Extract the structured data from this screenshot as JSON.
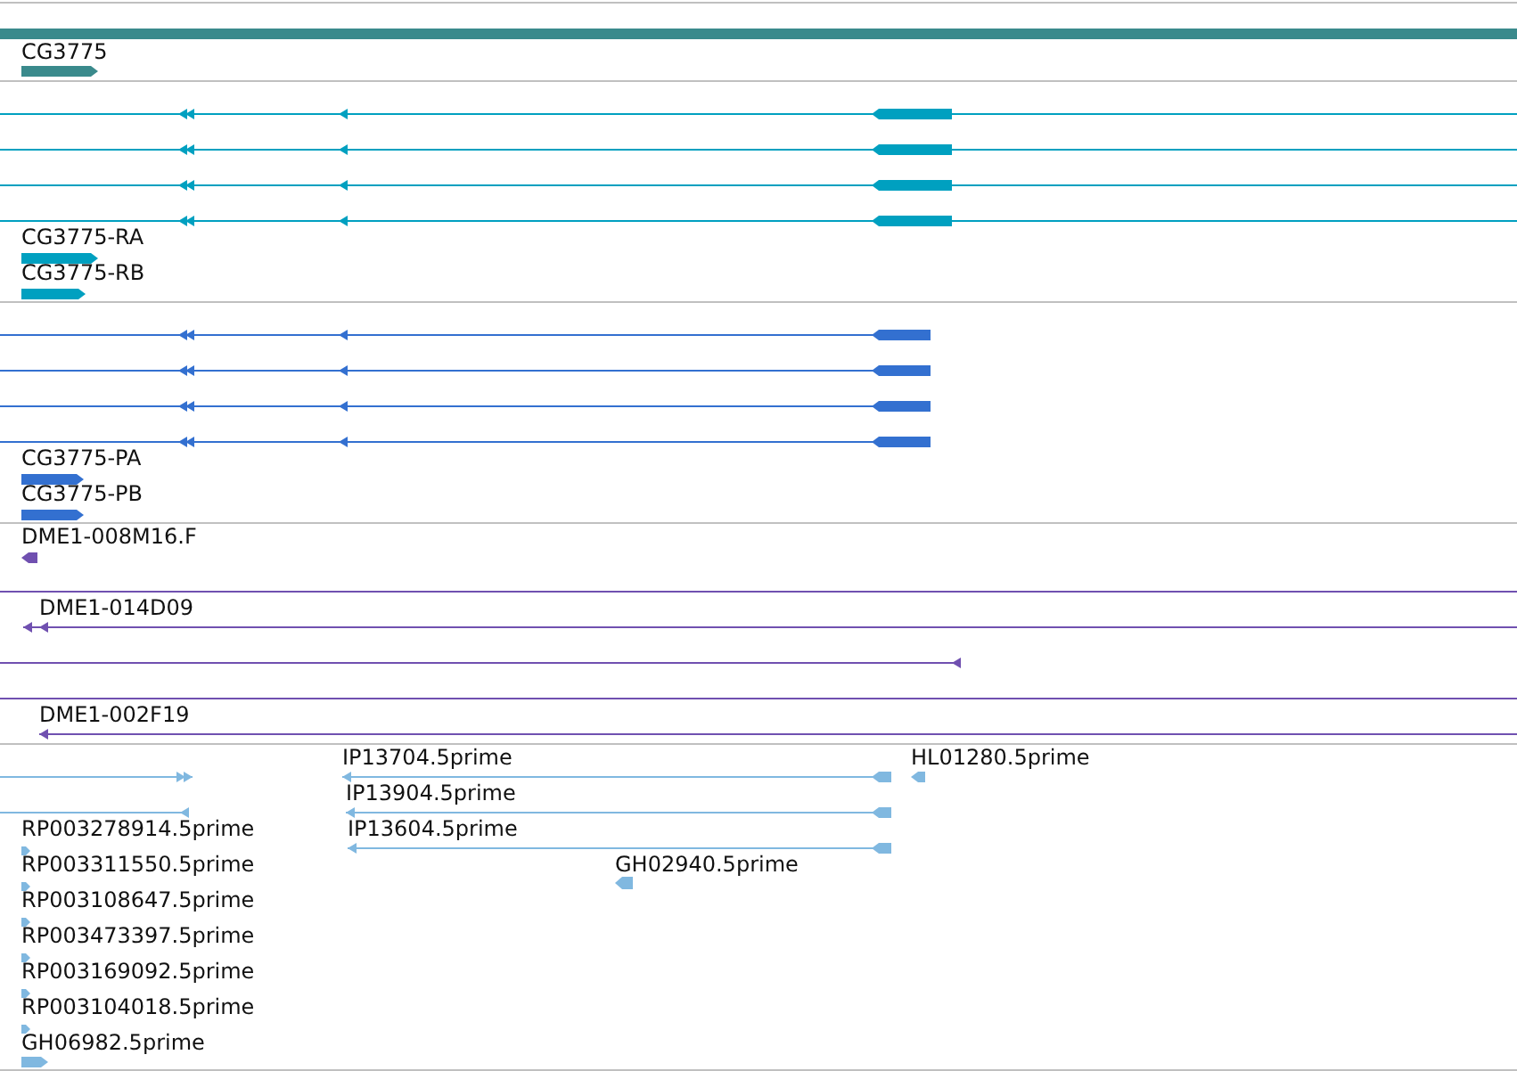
{
  "tracks": [
    {
      "color": "#3a8a8c",
      "features": [
        {
          "label": "CG3775",
          "reverse": false
        }
      ]
    },
    {
      "color": "#00a0c0",
      "features": [
        {
          "label": "CG3775-RA",
          "reverse": false
        },
        {
          "label": "CG3775-RB",
          "reverse": false
        }
      ]
    },
    {
      "color": "#3370d0",
      "features": [
        {
          "label": "CG3775-PA",
          "reverse": false
        },
        {
          "label": "CG3775-PB",
          "reverse": false
        }
      ]
    },
    {
      "color": "#7050b0",
      "features": [
        {
          "label": "DME1-008M16.F",
          "reverse": true
        },
        {
          "label": "DME1-014D09",
          "reverse": true
        },
        {
          "label": "DME1-002F19",
          "reverse": true
        }
      ]
    },
    {
      "color": "#80b8e0",
      "features": [
        {
          "label": "IP13704.5prime",
          "reverse": true
        },
        {
          "label": "HL01280.5prime",
          "reverse": true
        },
        {
          "label": "IP13904.5prime",
          "reverse": true
        },
        {
          "label": "RP003278914.5prime",
          "reverse": false
        },
        {
          "label": "IP13604.5prime",
          "reverse": true
        },
        {
          "label": "RP003311550.5prime",
          "reverse": false
        },
        {
          "label": "GH02940.5prime",
          "reverse": true
        },
        {
          "label": "RP003108647.5prime",
          "reverse": false
        },
        {
          "label": "RP003473397.5prime",
          "reverse": false
        },
        {
          "label": "RP003169092.5prime",
          "reverse": false
        },
        {
          "label": "RP003104018.5prime",
          "reverse": false
        },
        {
          "label": "GH06982.5prime",
          "reverse": false
        }
      ]
    }
  ]
}
